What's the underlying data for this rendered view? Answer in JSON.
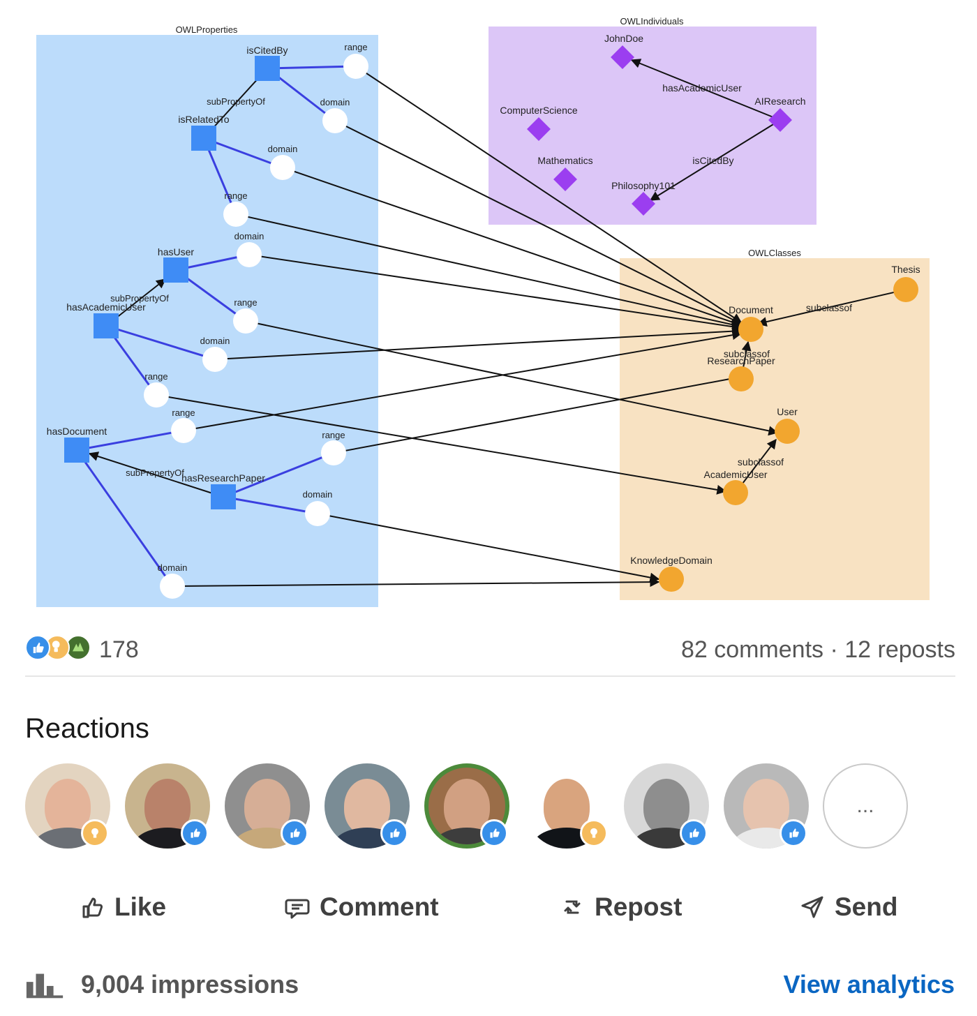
{
  "diagram": {
    "groups": {
      "properties": "OWLProperties",
      "individuals": "OWLIndividuals",
      "classes": "OWLClasses"
    },
    "properties": {
      "nodes": [
        "isCitedBy",
        "isRelatedTo",
        "hasUser",
        "hasAcademicUser",
        "hasDocument",
        "hasResearchPaper"
      ],
      "edge_labels": [
        "subPropertyOf",
        "subPropertyOf",
        "subPropertyOf"
      ],
      "endpoint_labels": [
        "range",
        "domain",
        "domain",
        "range",
        "domain",
        "range",
        "domain",
        "range",
        "range",
        "range",
        "domain",
        "domain"
      ]
    },
    "individuals": {
      "nodes": [
        "JohnDoe",
        "AIResearch",
        "ComputerScience",
        "Mathematics",
        "Philosophy101"
      ],
      "edge_labels": [
        "hasAcademicUser",
        "isCitedBy"
      ]
    },
    "classes": {
      "nodes": [
        "Thesis",
        "Document",
        "ResearchPaper",
        "User",
        "AcademicUser",
        "KnowledgeDomain"
      ],
      "edge_labels": [
        "subclassof",
        "subclassof",
        "subclassof"
      ]
    },
    "colors": {
      "properties_bg": "#bcdcfb",
      "individuals_bg": "#dcc6f7",
      "classes_bg": "#f8e2c2",
      "property_node": "#3f8cf5",
      "individual_node": "#9b3ef0",
      "class_node": "#f2a62f",
      "link": "#3a3fe0"
    }
  },
  "social": {
    "reaction_count": "178",
    "comments_reposts": "82 comments · 12 reposts",
    "reaction_icons": [
      "like-icon",
      "insightful-icon",
      "celebrate-icon"
    ]
  },
  "reactions": {
    "title": "Reactions",
    "more_label": "...",
    "avatars": [
      {
        "badge": "insightful"
      },
      {
        "badge": "like"
      },
      {
        "badge": "like"
      },
      {
        "badge": "like"
      },
      {
        "badge": "like",
        "ring": "#OPENTOWORK"
      },
      {
        "badge": "insightful"
      },
      {
        "badge": "like"
      },
      {
        "badge": "like"
      }
    ]
  },
  "actions": {
    "like": "Like",
    "comment": "Comment",
    "repost": "Repost",
    "send": "Send"
  },
  "analytics": {
    "impressions": "9,004 impressions",
    "view_label": "View analytics"
  }
}
